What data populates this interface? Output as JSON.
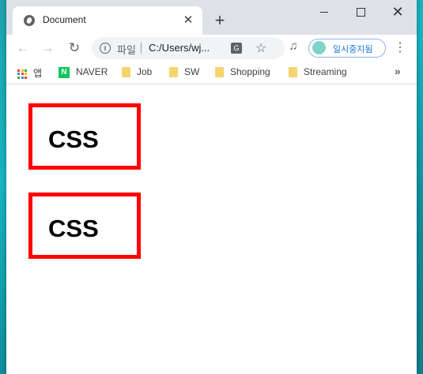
{
  "tab": {
    "title": "Document",
    "close": "✕",
    "new": "+"
  },
  "window_controls": {
    "close": "✕"
  },
  "toolbar": {
    "back": "←",
    "forward": "→",
    "reload": "↻",
    "url_scheme": "파일",
    "url": "C:/Users/wj...",
    "translate_icon": "G",
    "star": "☆",
    "media": "♫",
    "profile_label": "일시중지됨",
    "menu": "⋮"
  },
  "bookmarks": {
    "items": [
      {
        "label": "앱",
        "icon": "apps-grid-icon"
      },
      {
        "label": "NAVER",
        "icon": "naver-logo-icon"
      },
      {
        "label": "Job",
        "icon": "folder-icon"
      },
      {
        "label": "SW",
        "icon": "folder-icon"
      },
      {
        "label": "Shopping",
        "icon": "folder-icon"
      },
      {
        "label": "Streaming",
        "icon": "folder-icon"
      }
    ],
    "more": "»",
    "naver_glyph": "N"
  },
  "page": {
    "boxes": [
      {
        "text": "CSS"
      },
      {
        "text": "CSS"
      }
    ]
  },
  "colors": {
    "box_border": "#ff0000",
    "accent": "#1a73e8"
  }
}
